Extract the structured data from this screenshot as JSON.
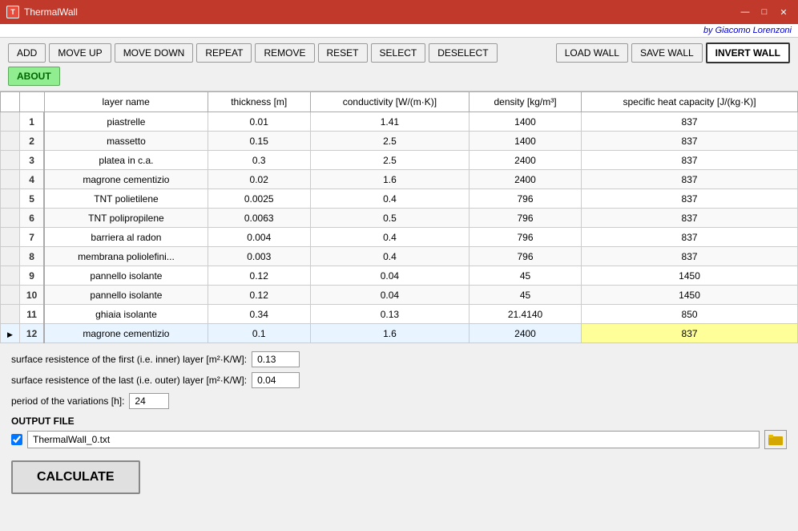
{
  "window": {
    "title": "ThermalWall",
    "subtitle": "by Giacomo Lorenzoni"
  },
  "toolbar": {
    "buttons": [
      "ADD",
      "MOVE UP",
      "MOVE DOWN",
      "REPEAT",
      "REMOVE",
      "RESET",
      "SELECT",
      "DESELECT"
    ],
    "right_buttons": [
      "LOAD WALL",
      "SAVE WALL",
      "INVERT WALL"
    ],
    "about_label": "ABOUT"
  },
  "table": {
    "headers": [
      "",
      "layer name",
      "thickness  [m]",
      "conductivity  [W/(m·K)]",
      "density  [kg/m³]",
      "specific heat capacity  [J/(kg·K)]"
    ],
    "rows": [
      {
        "num": 1,
        "name": "piastrelle",
        "thickness": "0.01",
        "conductivity": "1.41",
        "density": "1400",
        "heat_capacity": "837"
      },
      {
        "num": 2,
        "name": "massetto",
        "thickness": "0.15",
        "conductivity": "2.5",
        "density": "1400",
        "heat_capacity": "837"
      },
      {
        "num": 3,
        "name": "platea in c.a.",
        "thickness": "0.3",
        "conductivity": "2.5",
        "density": "2400",
        "heat_capacity": "837"
      },
      {
        "num": 4,
        "name": "magrone cementizio",
        "thickness": "0.02",
        "conductivity": "1.6",
        "density": "2400",
        "heat_capacity": "837"
      },
      {
        "num": 5,
        "name": "TNT polietilene",
        "thickness": "0.0025",
        "conductivity": "0.4",
        "density": "796",
        "heat_capacity": "837"
      },
      {
        "num": 6,
        "name": "TNT polipropilene",
        "thickness": "0.0063",
        "conductivity": "0.5",
        "density": "796",
        "heat_capacity": "837"
      },
      {
        "num": 7,
        "name": "barriera al radon",
        "thickness": "0.004",
        "conductivity": "0.4",
        "density": "796",
        "heat_capacity": "837"
      },
      {
        "num": 8,
        "name": "membrana poliolefini...",
        "thickness": "0.003",
        "conductivity": "0.4",
        "density": "796",
        "heat_capacity": "837"
      },
      {
        "num": 9,
        "name": "pannello isolante",
        "thickness": "0.12",
        "conductivity": "0.04",
        "density": "45",
        "heat_capacity": "1450"
      },
      {
        "num": 10,
        "name": "pannello isolante",
        "thickness": "0.12",
        "conductivity": "0.04",
        "density": "45",
        "heat_capacity": "1450"
      },
      {
        "num": 11,
        "name": "ghiaia isolante",
        "thickness": "0.34",
        "conductivity": "0.13",
        "density": "21.4140",
        "heat_capacity": "850"
      },
      {
        "num": 12,
        "name": "magrone cementizio",
        "thickness": "0.1",
        "conductivity": "1.6",
        "density": "2400",
        "heat_capacity": "837",
        "selected": true
      }
    ]
  },
  "fields": {
    "inner_resistance_label": "surface resistence of the first (i.e. inner) layer [m²·K/W]:",
    "inner_resistance_value": "0.13",
    "outer_resistance_label": "surface resistence of the last (i.e. outer) layer [m²·K/W]:",
    "outer_resistance_value": "0.04",
    "period_label": "period of the variations [h]:",
    "period_value": "24",
    "output_label": "OUTPUT FILE",
    "output_filename": "ThermalWall_0.txt",
    "calculate_label": "CALCULATE"
  }
}
